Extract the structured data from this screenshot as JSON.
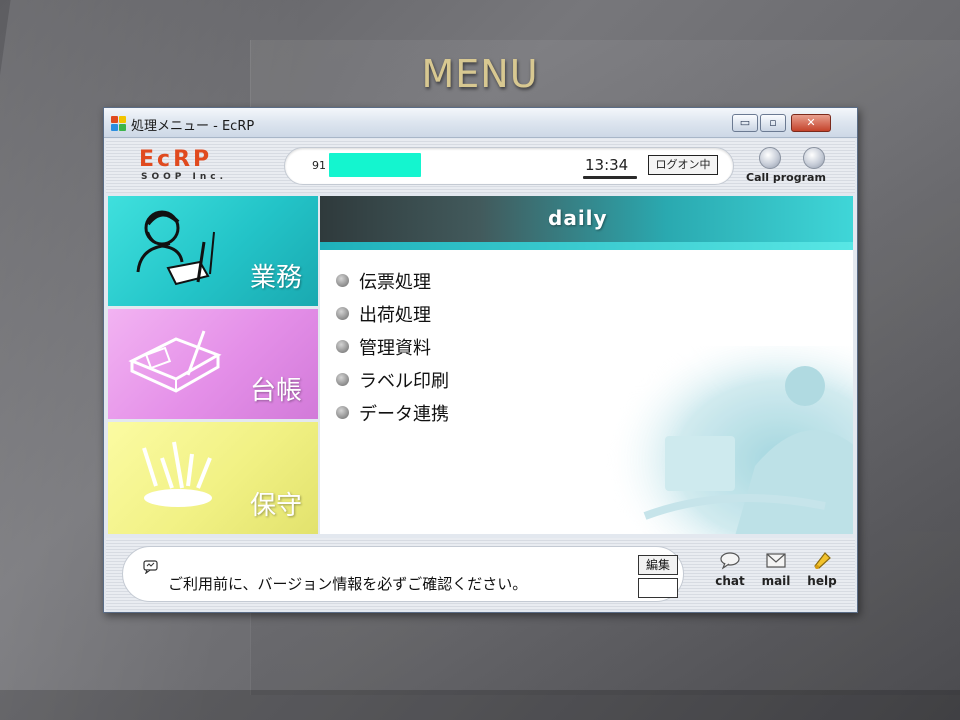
{
  "slide": {
    "title": "MENU"
  },
  "window": {
    "title": "処理メニュー - EcRP",
    "controls": {
      "minimize": "▭",
      "maximize": "▫",
      "close": "✕"
    }
  },
  "header": {
    "logo_main": "EcRP",
    "logo_sub": "SOOP Inc.",
    "user_code": "91",
    "time": "13:34",
    "logon_status": "ログオン中",
    "call_program_label": "Call program"
  },
  "categories": [
    {
      "label": "業務",
      "color": "#23c4c8"
    },
    {
      "label": "台帳",
      "color": "#e48fe8"
    },
    {
      "label": "保守",
      "color": "#f1f184"
    }
  ],
  "main": {
    "banner_title": "daily",
    "items": [
      {
        "label": "伝票処理"
      },
      {
        "label": "出荷処理"
      },
      {
        "label": "管理資料"
      },
      {
        "label": "ラベル印刷"
      },
      {
        "label": "データ連携"
      }
    ]
  },
  "footer": {
    "notice": "ご利用前に、バージョン情報を必ずご確認ください。",
    "edit_label": "編集",
    "tools": {
      "chat": "chat",
      "mail": "mail",
      "help": "help"
    }
  },
  "icons": [
    "app-icon",
    "call-program-icon",
    "operator-icon",
    "ledger-icon",
    "maintenance-icon",
    "bullet-icon",
    "notice-icon",
    "chat-icon",
    "mail-icon",
    "help-icon"
  ]
}
